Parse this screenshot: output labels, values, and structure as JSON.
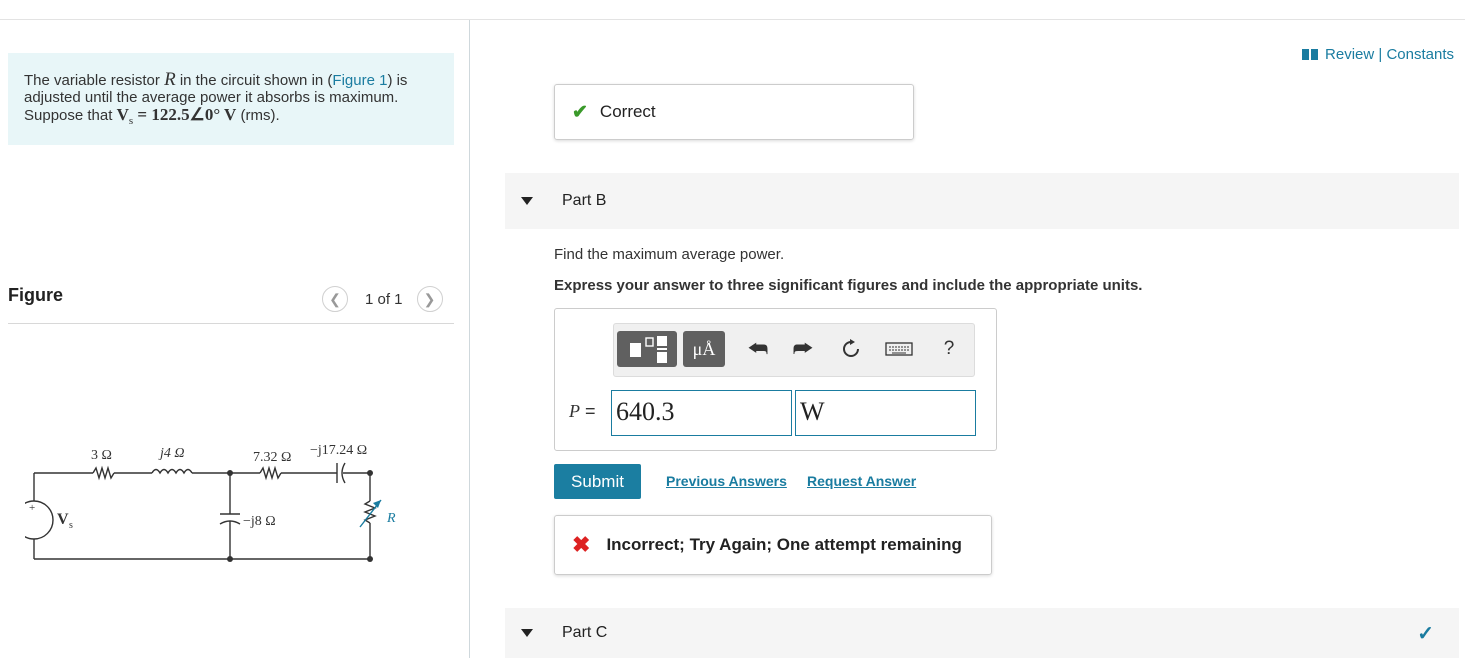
{
  "problem": {
    "text_before": "The variable resistor ",
    "var_r": "R",
    "text_mid": " in the circuit shown in (",
    "figure_link": "Figure 1",
    "text_mid2": ") is adjusted until the average power it absorbs is maximum. Suppose that ",
    "vs_symbol": "V",
    "vs_sub": "s",
    "vs_value": " = 122.5∠0° V",
    "text_end": " (rms)."
  },
  "figure": {
    "title": "Figure",
    "counter": "1 of 1",
    "prev_icon": "chevron-left-icon",
    "next_icon": "chevron-right-icon",
    "circuit_labels": {
      "r1": "3 Ω",
      "l1": "j4 Ω",
      "r2": "7.32 Ω",
      "c1": "−j17.24 Ω",
      "c2": "−j8 Ω",
      "source": "V",
      "source_sub": "s",
      "load": "R",
      "plus": "+"
    }
  },
  "header": {
    "review": "Review | Constants",
    "review_icon": "book-icon"
  },
  "partA": {
    "status": "Correct"
  },
  "partB": {
    "label": "Part B",
    "question": "Find the maximum average power.",
    "instruction": "Express your answer to three significant figures and include the appropriate units.",
    "toolbar": {
      "units_label": "μÅ",
      "help_label": "?"
    },
    "variable": "P",
    "equals": " =",
    "value": "640.3",
    "unit": "W",
    "submit_label": "Submit",
    "previous_answers": "Previous Answers",
    "request_answer": "Request Answer",
    "feedback": "Incorrect; Try Again; One attempt remaining"
  },
  "partC": {
    "label": "Part C"
  },
  "colors": {
    "accent": "#1a7ca0",
    "submit": "#1b7ea1",
    "correct": "#3a9a2a",
    "error": "#dd2222",
    "problem_bg": "#e8f6f8"
  }
}
